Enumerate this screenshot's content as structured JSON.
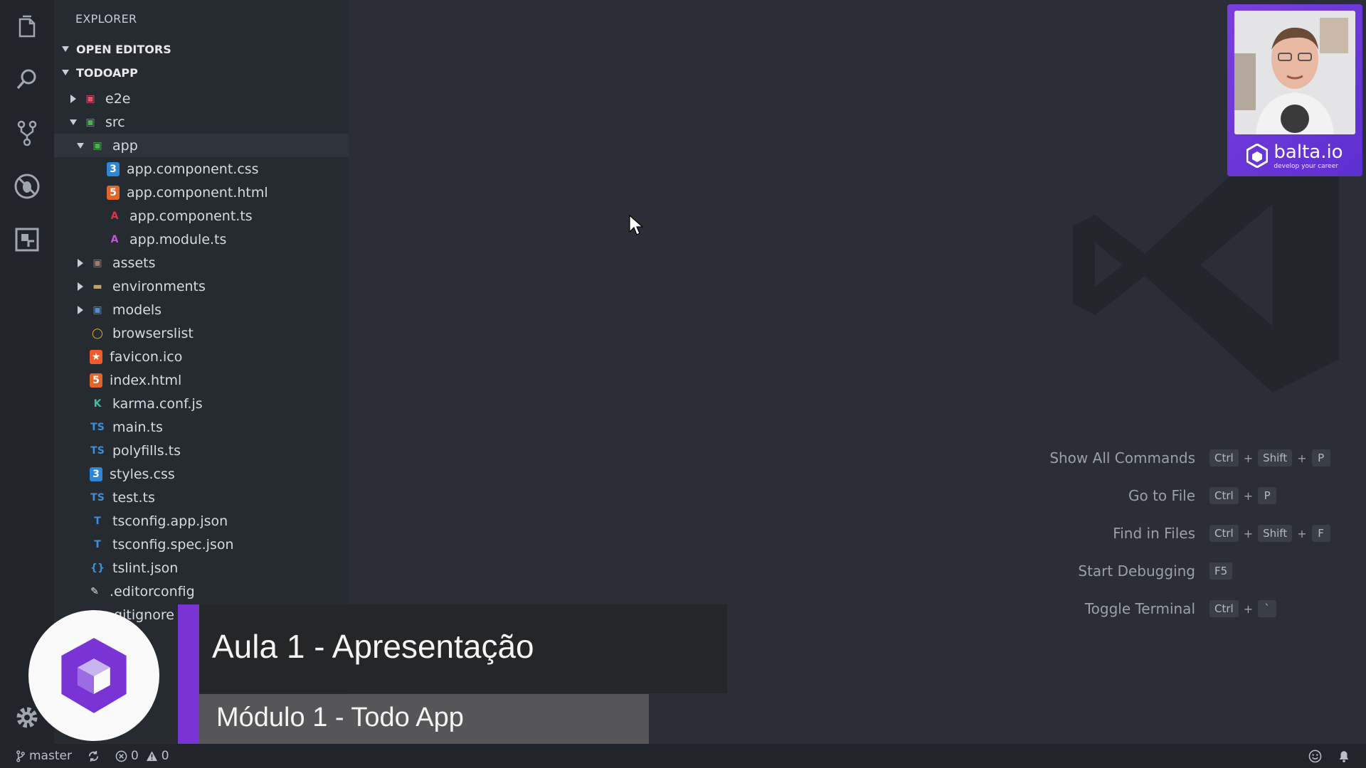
{
  "sidebar": {
    "title": "EXPLORER",
    "sections": {
      "open_editors": "OPEN EDITORS",
      "project": "TODOAPP"
    },
    "tree": [
      {
        "label": "e2e",
        "state": "closed",
        "level": 1,
        "icon": "e2e-folder-icon"
      },
      {
        "label": "src",
        "state": "open",
        "level": 1,
        "icon": "src-folder-icon"
      },
      {
        "label": "app",
        "state": "open",
        "level": 2,
        "icon": "app-folder-icon",
        "selected": true
      },
      {
        "label": "app.component.css",
        "level": 3,
        "icon": "css-file-icon"
      },
      {
        "label": "app.component.html",
        "level": 3,
        "icon": "html-file-icon"
      },
      {
        "label": "app.component.ts",
        "level": 3,
        "icon": "angular-file-icon"
      },
      {
        "label": "app.module.ts",
        "level": 3,
        "icon": "angular-module-icon"
      },
      {
        "label": "assets",
        "state": "closed",
        "level": 2,
        "icon": "assets-folder-icon"
      },
      {
        "label": "environments",
        "state": "closed",
        "level": 2,
        "icon": "folder-icon"
      },
      {
        "label": "models",
        "state": "closed",
        "level": 2,
        "icon": "models-folder-icon"
      },
      {
        "label": "browserslist",
        "level": 2,
        "icon": "browserslist-icon"
      },
      {
        "label": "favicon.ico",
        "level": 2,
        "icon": "favicon-icon"
      },
      {
        "label": "index.html",
        "level": 2,
        "icon": "html-file-icon"
      },
      {
        "label": "karma.conf.js",
        "level": 2,
        "icon": "karma-icon"
      },
      {
        "label": "main.ts",
        "level": 2,
        "icon": "ts-file-icon"
      },
      {
        "label": "polyfills.ts",
        "level": 2,
        "icon": "ts-file-icon"
      },
      {
        "label": "styles.css",
        "level": 2,
        "icon": "css-file-icon"
      },
      {
        "label": "test.ts",
        "level": 2,
        "icon": "ts-file-icon"
      },
      {
        "label": "tsconfig.app.json",
        "level": 2,
        "icon": "tsconfig-icon"
      },
      {
        "label": "tsconfig.spec.json",
        "level": 2,
        "icon": "tsconfig-icon"
      },
      {
        "label": "tslint.json",
        "level": 2,
        "icon": "tslint-icon"
      },
      {
        "label": ".editorconfig",
        "level": 1,
        "icon": "editorconfig-icon"
      },
      {
        "label": ".gitignore",
        "level": 1,
        "icon": "git-icon"
      }
    ]
  },
  "welcome": {
    "shortcuts": [
      {
        "label": "Show All Commands",
        "keys": [
          "Ctrl",
          "Shift",
          "P"
        ]
      },
      {
        "label": "Go to File",
        "keys": [
          "Ctrl",
          "P"
        ]
      },
      {
        "label": "Find in Files",
        "keys": [
          "Ctrl",
          "Shift",
          "F"
        ]
      },
      {
        "label": "Start Debugging",
        "keys": [
          "F5"
        ]
      },
      {
        "label": "Toggle Terminal",
        "keys": [
          "Ctrl",
          "`"
        ]
      }
    ]
  },
  "overlay": {
    "title": "Aula 1 - Apresentação",
    "subtitle": "Módulo 1 - Todo App",
    "brand": "balta.io",
    "brand_tagline": "develop your career"
  },
  "status": {
    "branch": "master",
    "errors": "0",
    "warnings": "0"
  },
  "colors": {
    "accent": "#7a34d6",
    "editor_bg": "#2b2e36",
    "sidebar_bg": "#262a31"
  }
}
